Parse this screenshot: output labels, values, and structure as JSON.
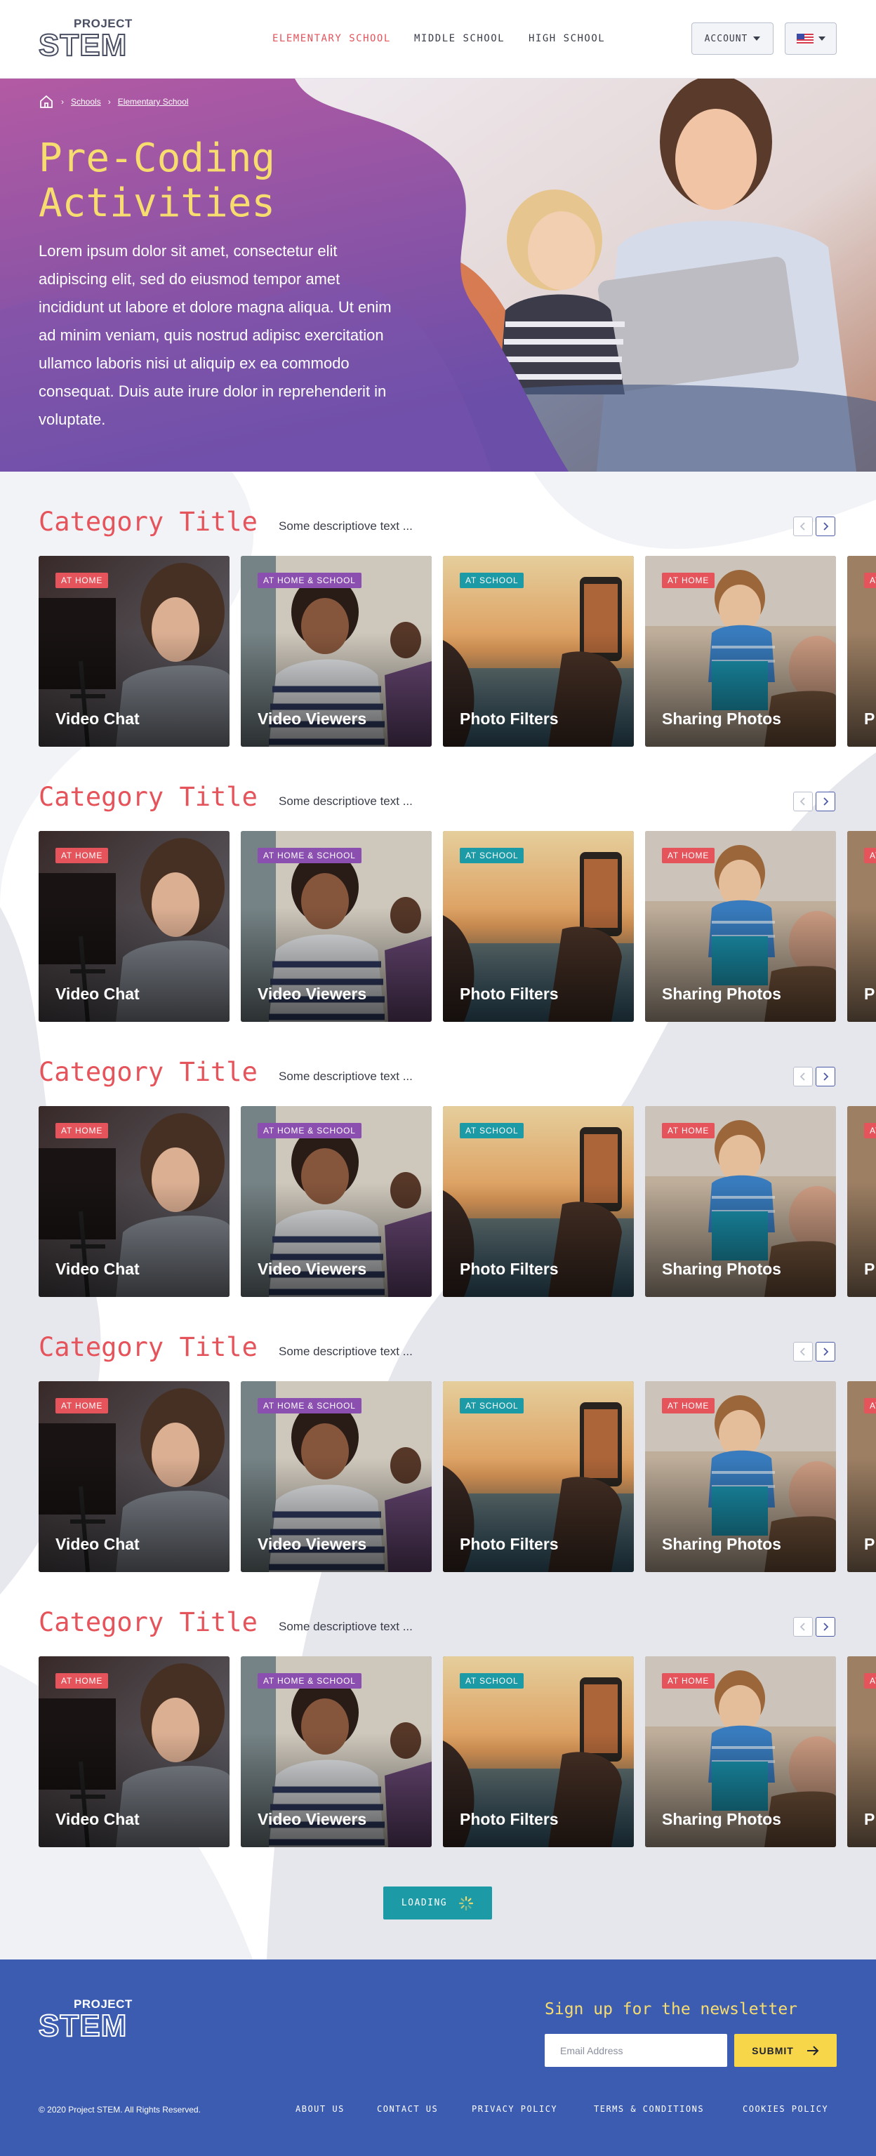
{
  "brand": {
    "line1": "PROJECT",
    "line2": "STEM"
  },
  "nav": {
    "items": [
      {
        "label": "ELEMENTARY SCHOOL",
        "active": true
      },
      {
        "label": "MIDDLE SCHOOL",
        "active": false
      },
      {
        "label": "HIGH SCHOOL",
        "active": false
      }
    ],
    "account_label": "ACCOUNT",
    "language_icon": "us-flag-icon"
  },
  "hero": {
    "breadcrumb": [
      "Schools",
      "Elementary School"
    ],
    "title": "Pre-Coding Activities",
    "body": "Lorem ipsum dolor sit amet, consectetur elit adipiscing elit, sed do eiusmod tempor amet incididunt ut labore et dolore magna aliqua. Ut enim ad minim veniam, quis nostrud adipisc exercitation ullamco laboris nisi ut aliquip ex ea commodo consequat. Duis aute irure dolor in reprehenderit in voluptate."
  },
  "categories": [
    {
      "title": "Category Title",
      "description": "Some descriptiove text ..."
    },
    {
      "title": "Category Title",
      "description": "Some descriptiove text ..."
    },
    {
      "title": "Category Title",
      "description": "Some descriptiove text ..."
    },
    {
      "title": "Category Title",
      "description": "Some descriptiove text ..."
    },
    {
      "title": "Category Title",
      "description": "Some descriptiove text ..."
    }
  ],
  "cards": [
    {
      "badge": "AT HOME",
      "badge_color": "#e5535b",
      "title": "Video Chat"
    },
    {
      "badge": "AT HOME & SCHOOL",
      "badge_color": "#8b4fb0",
      "title": "Video Viewers"
    },
    {
      "badge": "AT SCHOOL",
      "badge_color": "#1c9aa6",
      "title": "Photo Filters"
    },
    {
      "badge": "AT HOME",
      "badge_color": "#e5535b",
      "title": "Sharing Photos"
    },
    {
      "badge": "AT HOME",
      "badge_color": "#e5535b",
      "title": "P"
    }
  ],
  "loading_label": "LOADING",
  "footer": {
    "newsletter_title": "Sign up for the newsletter",
    "email_placeholder": "Email Address",
    "submit_label": "SUBMIT",
    "copyright": "© 2020 Project STEM. All Rights Reserved.",
    "links": [
      "ABOUT US",
      "CONTACT US",
      "PRIVACY POLICY",
      "TERMS & CONDITIONS",
      "COOKIES POLICY"
    ]
  },
  "colors": {
    "accent_red": "#e5535b",
    "title_yellow": "#f7dc6f",
    "purple": "#8b4fb0",
    "teal": "#1c9aa6",
    "footer_blue": "#3c5cb1",
    "submit_yellow": "#f7d64a"
  }
}
